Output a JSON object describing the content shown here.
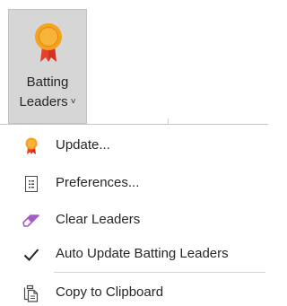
{
  "ribbon_button": {
    "label_line1": "Batting",
    "label_line2": "Leaders",
    "chevron": "˅",
    "icon": "award-ribbon-icon",
    "pressed": true
  },
  "menu": {
    "items": [
      {
        "label": "Update...",
        "icon": "award-ribbon-icon"
      },
      {
        "label": "Preferences...",
        "icon": "document-list-icon"
      },
      {
        "label": "Clear Leaders",
        "icon": "eraser-icon"
      },
      {
        "label": "Auto Update Batting Leaders",
        "icon": "checkmark-icon",
        "checked": true
      },
      {
        "label": "Copy to Clipboard",
        "icon": "copy-clipboard-icon"
      }
    ]
  },
  "colors": {
    "award_orange": "#f5a21c",
    "award_red": "#e8412a",
    "eraser_purple": "#a45cc8",
    "pressed_bg": "#d6d6d6"
  }
}
